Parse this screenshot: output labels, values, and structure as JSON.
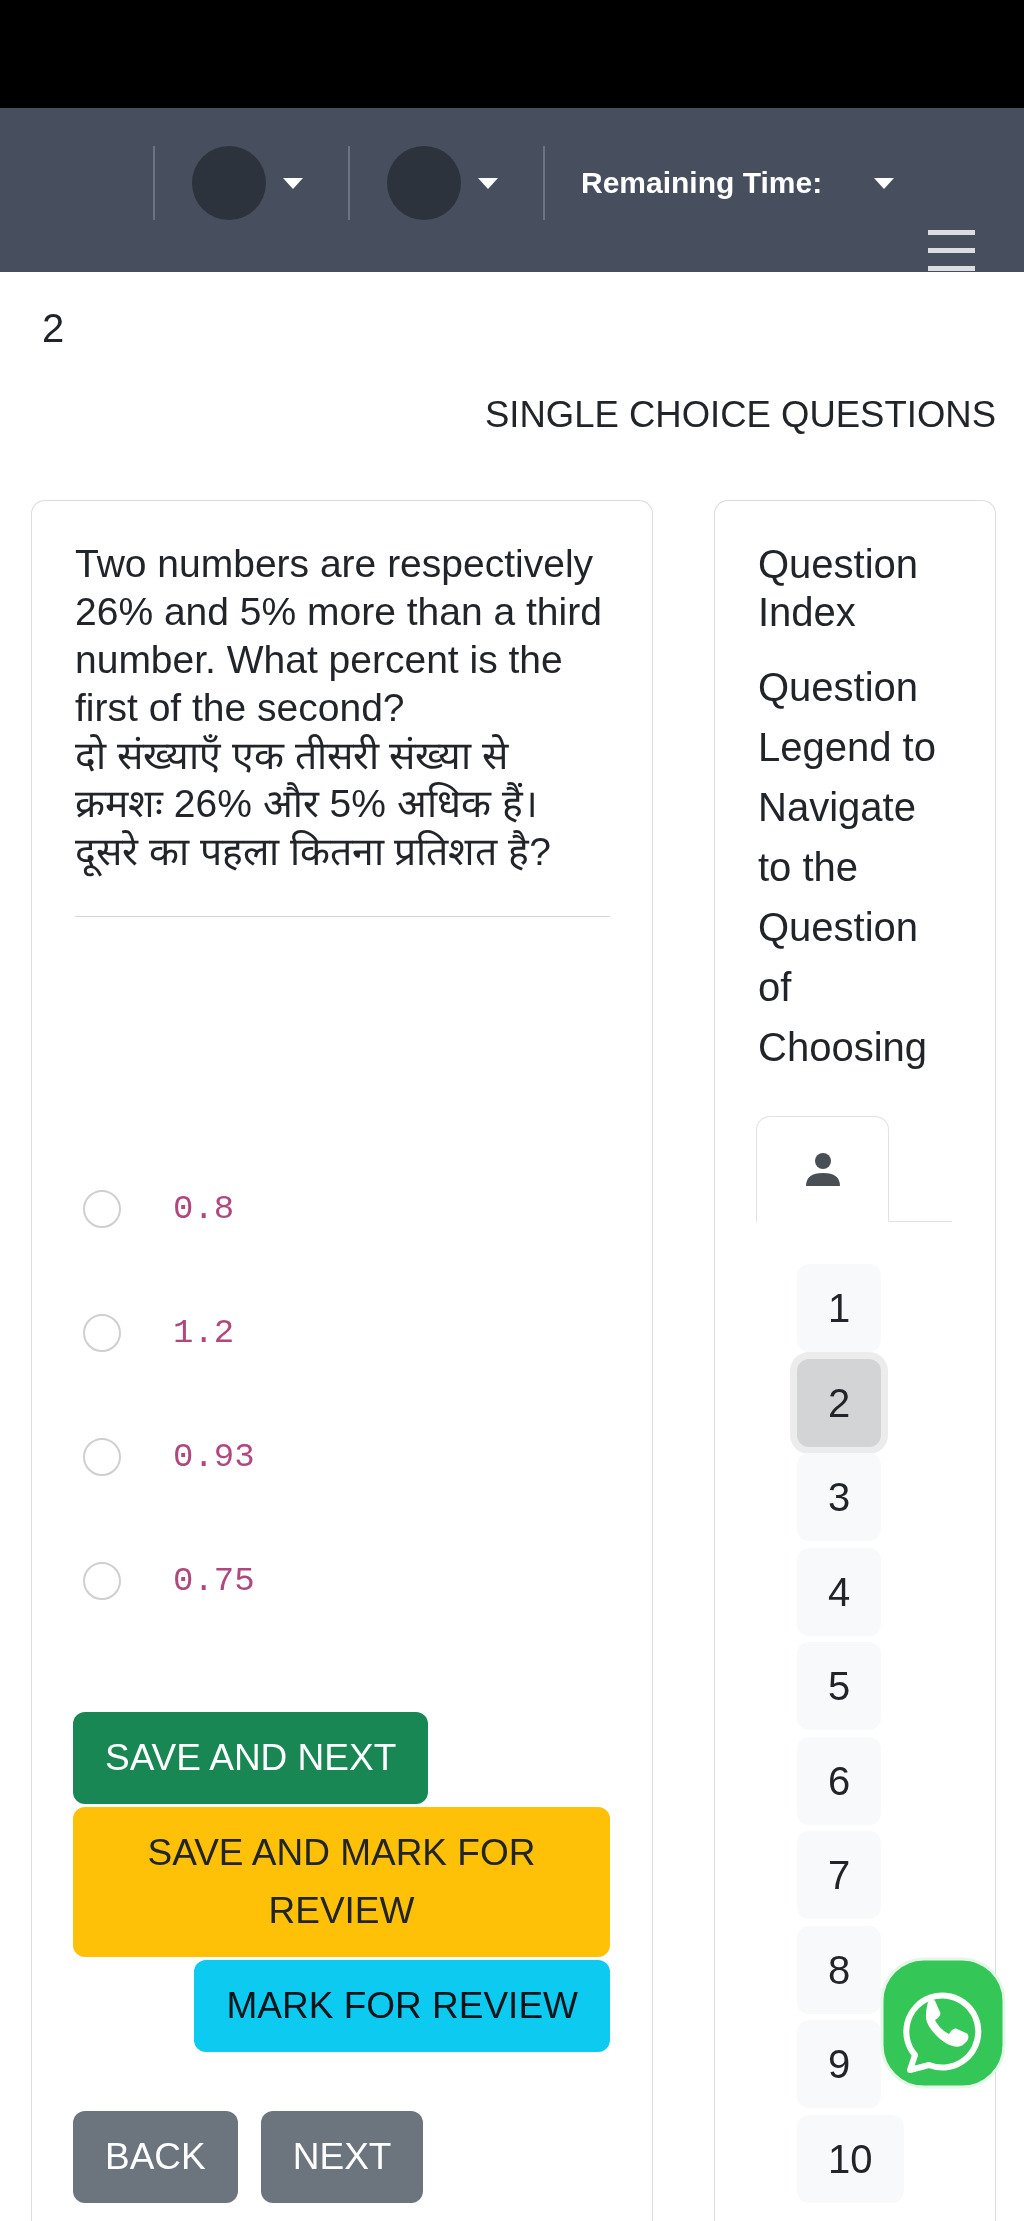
{
  "navbar": {
    "timer_label": "Remaining Time:"
  },
  "question_number": "2",
  "section_title": "SINGLE CHOICE QUESTIONS",
  "question": {
    "text": "Two numbers are respectively 26% and 5% more than a third number. What percent is the first of the second?",
    "translation": "दो संख्याएँ एक तीसरी संख्या से क्रमशः 26% और 5% अधिक हैं। दूसरे का पहला कितना प्रतिशत है?"
  },
  "options": [
    {
      "label": "0.8",
      "selected": false
    },
    {
      "label": "1.2",
      "selected": false
    },
    {
      "label": "0.93",
      "selected": false
    },
    {
      "label": "0.75",
      "selected": false
    }
  ],
  "actions": [
    {
      "label": "SAVE AND NEXT",
      "kind": "success"
    },
    {
      "label": "SAVE AND MARK FOR REVIEW",
      "kind": "warning"
    },
    {
      "label": "MARK FOR REVIEW",
      "kind": "info"
    }
  ],
  "navigation": [
    {
      "label": "BACK"
    },
    {
      "label": "NEXT"
    }
  ],
  "question_index": {
    "title": "Question Index",
    "legend": "Question Legend to Navigate to the Question of Choosing",
    "tabs": [
      {
        "selected": true
      }
    ],
    "questions": [
      {
        "label": "1",
        "selected": false
      },
      {
        "label": "2",
        "selected": true
      },
      {
        "label": "3",
        "selected": false
      },
      {
        "label": "4",
        "selected": false
      },
      {
        "label": "5",
        "selected": false
      },
      {
        "label": "6",
        "selected": false
      },
      {
        "label": "7",
        "selected": false
      },
      {
        "label": "8",
        "selected": false
      },
      {
        "label": "9",
        "selected": false
      },
      {
        "label": "10",
        "selected": false
      }
    ]
  }
}
